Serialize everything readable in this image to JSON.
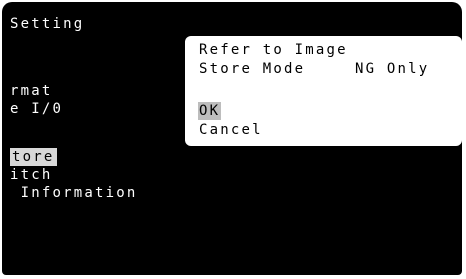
{
  "background_menu": {
    "title": "Setting",
    "items": [
      "rmat",
      "e I/0",
      "tore",
      "itch",
      " Information"
    ],
    "selected_index": 2
  },
  "dialog": {
    "line1": "Refer to Image",
    "store_mode_label": "Store Mode",
    "store_mode_value": "NG Only",
    "ok_label": "OK",
    "cancel_label": "Cancel"
  },
  "colors": {
    "screen_bg": "#000000",
    "text": "#ffffff",
    "dialog_bg": "#ffffff",
    "highlight": "#d8d8d8",
    "ok_highlight": "#bdbdbd"
  }
}
